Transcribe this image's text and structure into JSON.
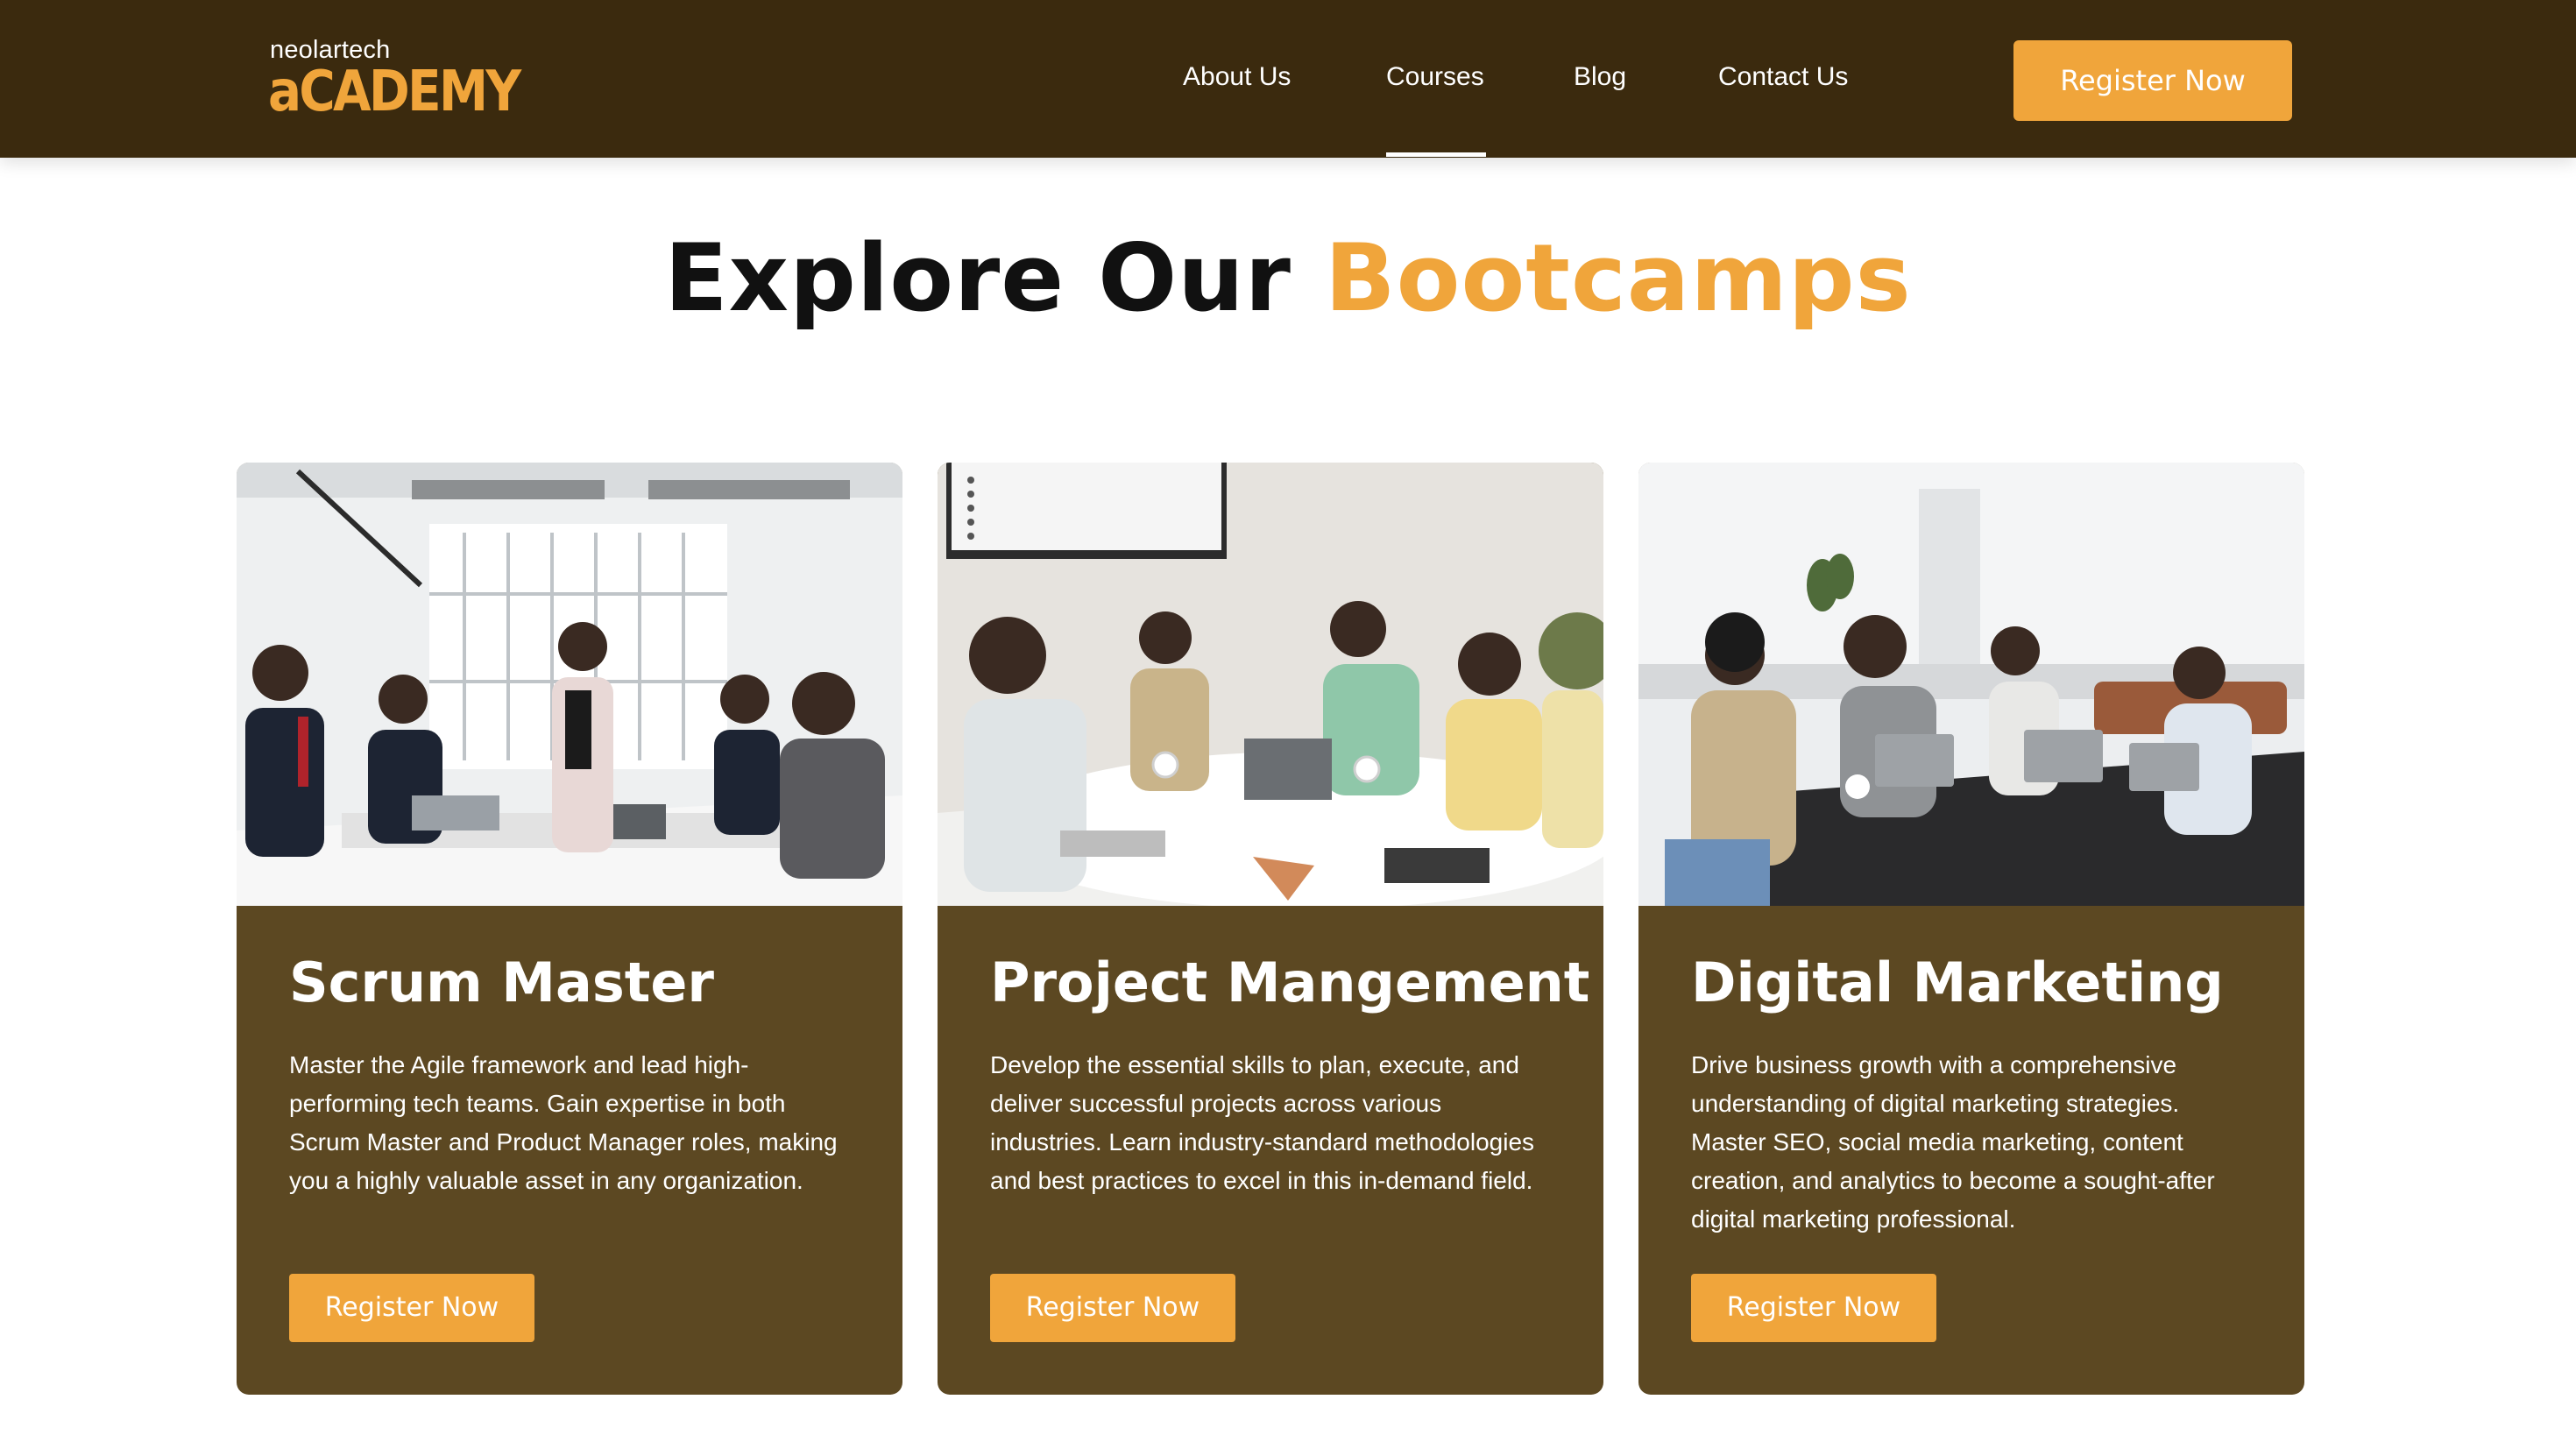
{
  "brand": {
    "top_text": "neolartech",
    "main_text": "aCADEMY",
    "accent_color": "#f0a53b",
    "header_bg": "#3b2a0e",
    "card_bg": "#5c4822"
  },
  "nav": {
    "items": [
      {
        "label": "About Us",
        "active": false
      },
      {
        "label": "Courses",
        "active": true
      },
      {
        "label": "Blog",
        "active": false
      },
      {
        "label": "Contact Us",
        "active": false
      }
    ],
    "cta_label": "Register Now"
  },
  "section": {
    "title_prefix": "Explore Our",
    "title_accent": "Bootcamps"
  },
  "cards": [
    {
      "title": "Scrum Master",
      "description": "Master the Agile framework and lead high-performing tech teams. Gain expertise in both Scrum Master and Product Manager roles, making you a highly valuable asset in any organization.",
      "button_label": "Register Now",
      "image_icon": "team-meeting-photo"
    },
    {
      "title": "Project Mangement",
      "description": "Develop the essential skills to plan, execute, and deliver successful projects across various industries. Learn industry-standard methodologies and best practices to excel in this in-demand field.",
      "button_label": "Register Now",
      "image_icon": "team-discussion-photo"
    },
    {
      "title": "Digital Marketing",
      "description": "Drive business growth with a comprehensive understanding of digital marketing strategies. Master SEO, social media marketing, content creation, and analytics to become a sought-after digital marketing professional.",
      "button_label": "Register Now",
      "image_icon": "laptop-meeting-photo"
    }
  ]
}
